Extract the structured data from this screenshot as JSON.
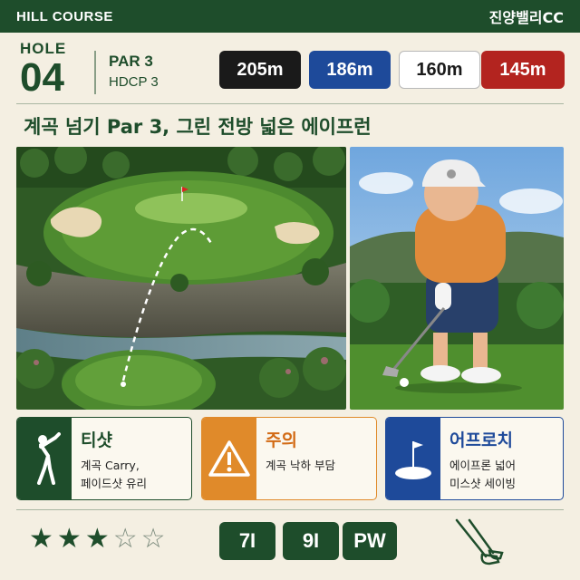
{
  "header": {
    "course": "HILL COURSE",
    "club_name": "진양밸리CC"
  },
  "hole": {
    "label": "HOLE",
    "number": "04",
    "par": "PAR 3",
    "hdcp": "HDCP 3"
  },
  "tees": [
    {
      "distance": "205m",
      "color": "#1a1a1a"
    },
    {
      "distance": "186m",
      "color": "#1e4a9a"
    },
    {
      "distance": "160m",
      "color": "#ffffff"
    },
    {
      "distance": "145m",
      "color": "#b3241f"
    }
  ],
  "headline": "계곡 넘기 Par 3, 그린 전방 넓은 에이프런",
  "tips": [
    {
      "title": "티샷",
      "lines": [
        "계곡 Carry,",
        "페이드샷 유리"
      ],
      "icon": "golfer-swing-icon",
      "color": "#1e4d2b"
    },
    {
      "title": "주의",
      "lines": [
        "계곡 낙하 부담"
      ],
      "icon": "warning-icon",
      "color": "#e08a2a"
    },
    {
      "title": "어프로치",
      "lines": [
        "에이프론 넓어",
        "미스샷 세이빙"
      ],
      "icon": "flag-green-icon",
      "color": "#1e4a9a"
    }
  ],
  "difficulty": {
    "rating": 3,
    "max": 5
  },
  "clubs": [
    "7I",
    "9I",
    "PW"
  ]
}
